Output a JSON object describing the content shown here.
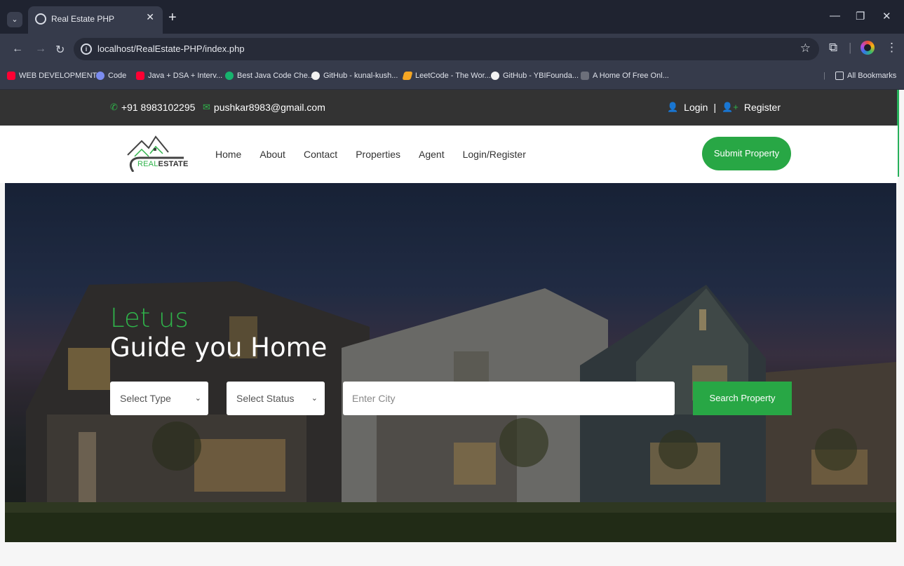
{
  "browser": {
    "tab_title": "Real Estate PHP",
    "url": "localhost/RealEstate-PHP/index.php",
    "bookmarks": [
      {
        "label": "WEB DEVELOPMENT",
        "icon": "youtube-icon"
      },
      {
        "label": "Code",
        "icon": "code-icon"
      },
      {
        "label": "Java + DSA + Interv...",
        "icon": "youtube-icon"
      },
      {
        "label": "Best Java Code Che...",
        "icon": "bookmark-icon"
      },
      {
        "label": "GitHub - kunal-kush...",
        "icon": "github-icon"
      },
      {
        "label": "LeetCode - The Wor...",
        "icon": "leetcode-icon"
      },
      {
        "label": "GitHub - YBIFounda...",
        "icon": "github-icon"
      },
      {
        "label": "A Home Of Free Onl...",
        "icon": "home-icon"
      }
    ],
    "all_bookmarks": "All Bookmarks"
  },
  "topbar": {
    "phone": "+91 8983102295",
    "email": "pushkar8983@gmail.com",
    "login": "Login",
    "separator": "|",
    "register": "Register"
  },
  "nav": {
    "logo_text_prefix": "REAL",
    "logo_text_suffix": "ESTATE",
    "items": [
      "Home",
      "About",
      "Contact",
      "Properties",
      "Agent",
      "Login/Register"
    ],
    "submit_property": "Submit Property"
  },
  "hero": {
    "line1": "Let us",
    "line2": "Guide you Home",
    "type_select": "Select Type",
    "status_select": "Select Status",
    "city_placeholder": "Enter City",
    "search_button": "Search Property"
  },
  "colors": {
    "accent": "#28a745",
    "topbar": "#333333"
  }
}
